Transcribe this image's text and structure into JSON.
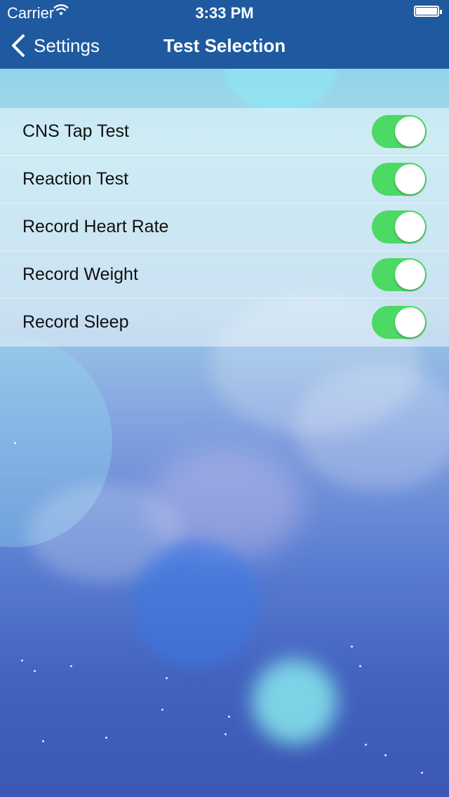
{
  "status_bar": {
    "carrier": "Carrier",
    "time": "3:33 PM",
    "wifi_icon": "wifi-icon",
    "battery_icon": "battery-icon"
  },
  "nav_bar": {
    "back_label": "Settings",
    "title": "Test Selection",
    "color": "#1f5aa0"
  },
  "tests": [
    {
      "label": "CNS Tap Test",
      "enabled": true
    },
    {
      "label": "Reaction Test",
      "enabled": true
    },
    {
      "label": "Record Heart Rate",
      "enabled": true
    },
    {
      "label": "Record Weight",
      "enabled": true
    },
    {
      "label": "Record Sleep",
      "enabled": true
    }
  ],
  "toggle_on_color": "#4cd964"
}
